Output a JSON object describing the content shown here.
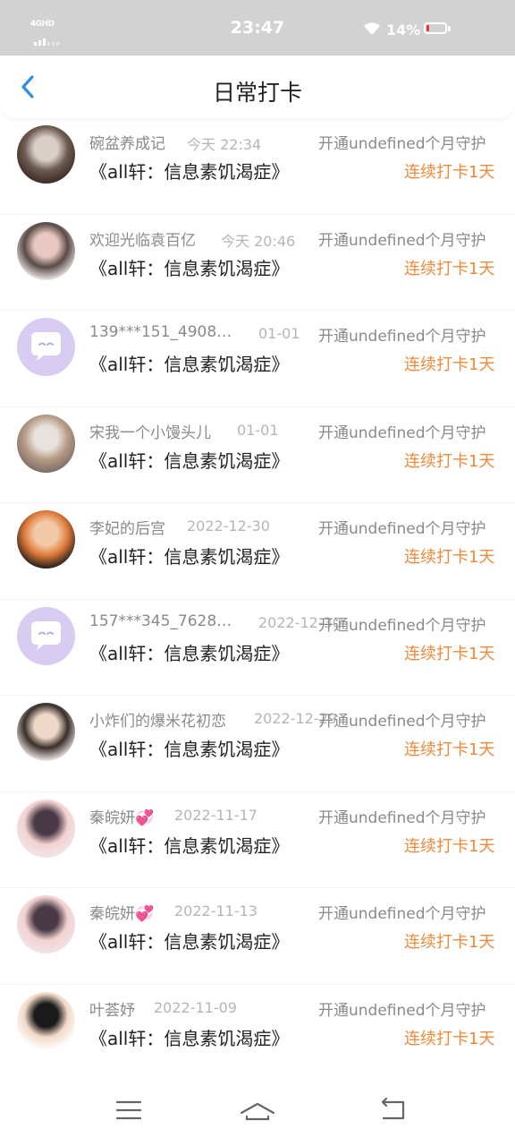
{
  "status_bar": {
    "network": "4GHD",
    "time": "23:47",
    "battery": "14%",
    "battery_level": 0.14,
    "battery_color": "#e8343a"
  },
  "header": {
    "title": "日常打卡",
    "back_icon": "chevron-left-icon",
    "accent_color": "#2f8fe6"
  },
  "checkins": [
    {
      "nickname": "碗盆养成记",
      "time": "今天 22:34",
      "guard": "开通undefined个月守护",
      "book": "《all轩：信息素饥渴症》",
      "streak": "连续打卡1天",
      "avatar": "photo"
    },
    {
      "nickname": "欢迎光临袁百亿",
      "time": "今天 20:46",
      "guard": "开通undefined个月守护",
      "book": "《all轩：信息素饥渴症》",
      "streak": "连续打卡1天",
      "avatar": "photo"
    },
    {
      "nickname": "139***151_4908…",
      "time": "01-01",
      "guard": "开通undefined个月守护",
      "book": "《all轩：信息素饥渴症》",
      "streak": "连续打卡1天",
      "avatar": "default"
    },
    {
      "nickname": "宋我一个小馒头儿",
      "time": "01-01",
      "guard": "开通undefined个月守护",
      "book": "《all轩：信息素饥渴症》",
      "streak": "连续打卡1天",
      "avatar": "photo"
    },
    {
      "nickname": "李妃的后宫",
      "time": "2022-12-30",
      "guard": "开通undefined个月守护",
      "book": "《all轩：信息素饥渴症》",
      "streak": "连续打卡1天",
      "avatar": "photo"
    },
    {
      "nickname": "157***345_7628…",
      "time": "2022-12-30",
      "guard": "开通undefined个月守护",
      "book": "《all轩：信息素饥渴症》",
      "streak": "连续打卡1天",
      "avatar": "default"
    },
    {
      "nickname": "小炸们的爆米花初恋",
      "time": "2022-12-29",
      "guard": "开通undefined个月守护",
      "book": "《all轩：信息素饥渴症》",
      "streak": "连续打卡1天",
      "avatar": "photo"
    },
    {
      "nickname": "秦皖妍💞",
      "time": "2022-11-17",
      "guard": "开通undefined个月守护",
      "book": "《all轩：信息素饥渴症》",
      "streak": "连续打卡1天",
      "avatar": "photo"
    },
    {
      "nickname": "秦皖妍💞",
      "time": "2022-11-13",
      "guard": "开通undefined个月守护",
      "book": "《all轩：信息素饥渴症》",
      "streak": "连续打卡1天",
      "avatar": "photo"
    },
    {
      "nickname": "叶荟妤",
      "time": "2022-11-09",
      "guard": "开通undefined个月守护",
      "book": "《all轩：信息素饥渴症》",
      "streak": "连续打卡1天",
      "avatar": "photo"
    }
  ],
  "colors": {
    "streak": "#f0893a",
    "default_avatar": "#d9ccf2"
  },
  "bottom_nav": {
    "icons": [
      "menu-icon",
      "home-icon",
      "back-arrow-icon"
    ]
  }
}
